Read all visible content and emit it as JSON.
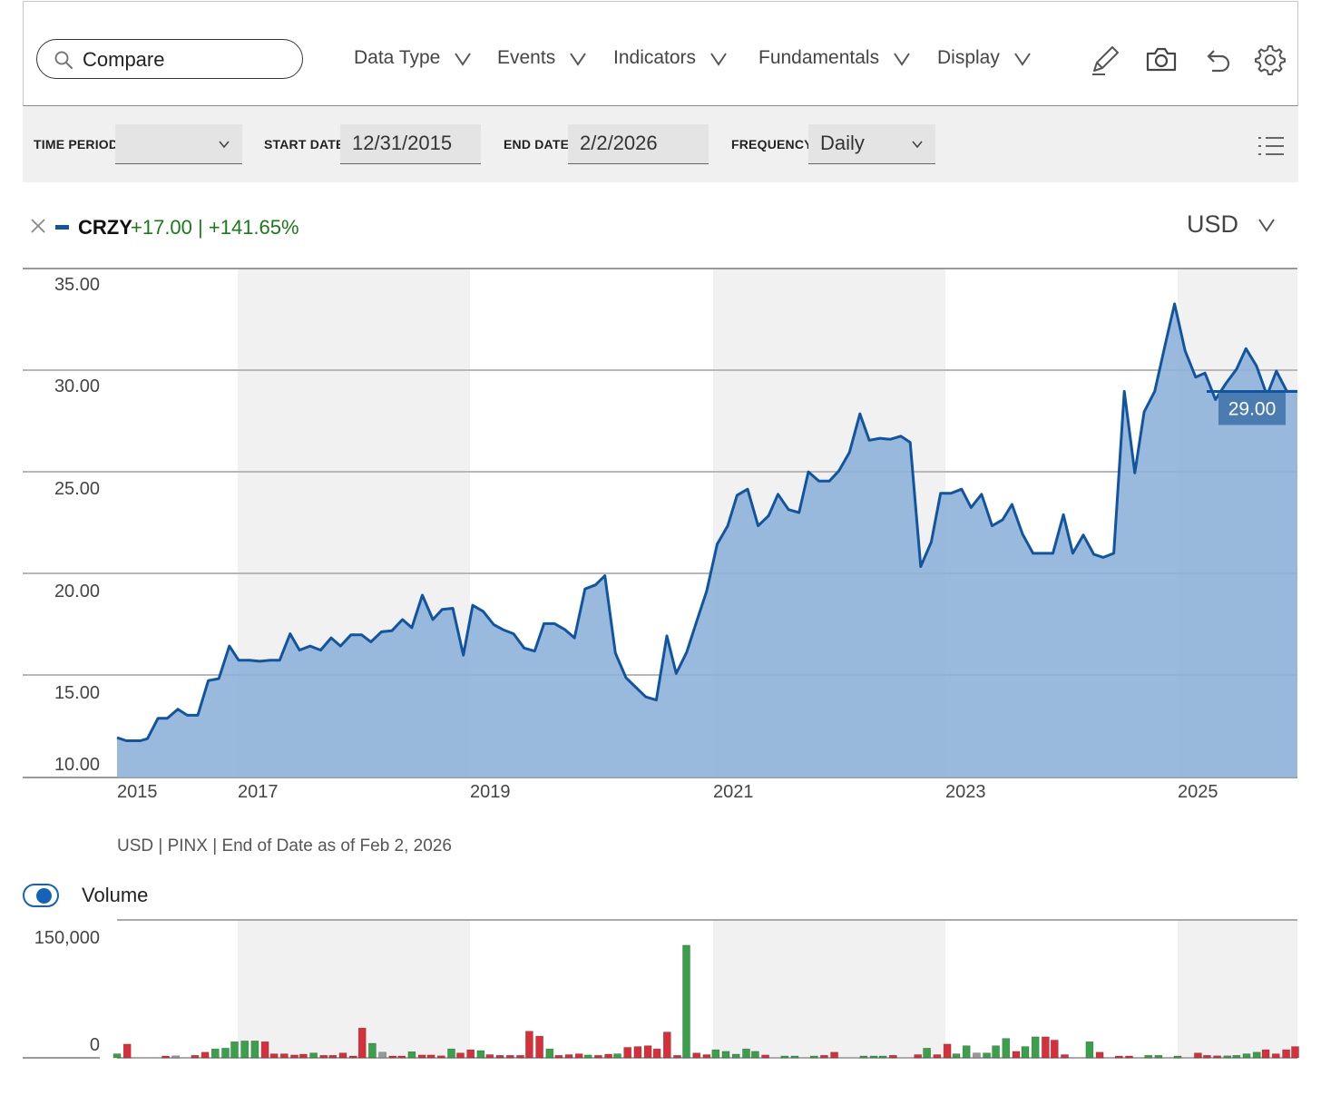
{
  "toolbar": {
    "search_label": "Compare",
    "menus": [
      "Data Type",
      "Events",
      "Indicators",
      "Fundamentals",
      "Display"
    ],
    "tools": [
      "pencil-icon",
      "camera-icon",
      "undo-icon",
      "gear-icon"
    ]
  },
  "filters": {
    "time_period_label": "TIME PERIOD",
    "time_period_value": "",
    "start_date_label": "START DATE",
    "start_date_value": "12/31/2015",
    "end_date_label": "END DATE",
    "end_date_value": "2/2/2026",
    "frequency_label": "FREQUENCY",
    "frequency_value": "Daily"
  },
  "legend": {
    "symbol": "CRZY",
    "change": "+17.00",
    "separator": "|",
    "change_pct": "+141.65%",
    "currency": "USD"
  },
  "footnote": "USD | PINX | End of Date as of Feb 2, 2026",
  "volume": {
    "label": "Volume",
    "enabled": true
  },
  "colors": {
    "line": "#1155a0",
    "fill": "#8fb3d9",
    "price_tag": "#4a7cb2",
    "volume_up": "#3aa04a",
    "volume_down": "#d8303a",
    "band": "#f1f1f1"
  },
  "chart_data": [
    {
      "type": "area",
      "x_tick_labels": [
        "2015",
        "2017",
        "2019",
        "2021",
        "2023",
        "2025"
      ],
      "y_tick_labels": [
        "35.00",
        "30.00",
        "25.00",
        "20.00",
        "15.00",
        "10.00"
      ],
      "ylim": [
        10,
        35
      ],
      "xlim": [
        2016.0,
        2026.09
      ],
      "last_value_label": "29.00",
      "series": [
        {
          "points": [
            [
              2016.0,
              12.0
            ],
            [
              2016.08,
              11.85
            ],
            [
              2016.2,
              11.85
            ],
            [
              2016.26,
              11.95
            ],
            [
              2016.35,
              12.95
            ],
            [
              2016.43,
              12.95
            ],
            [
              2016.52,
              13.4
            ],
            [
              2016.6,
              13.1
            ],
            [
              2016.69,
              13.1
            ],
            [
              2016.78,
              14.8
            ],
            [
              2016.87,
              14.9
            ],
            [
              2016.96,
              16.5
            ],
            [
              2017.04,
              15.8
            ],
            [
              2017.13,
              15.8
            ],
            [
              2017.22,
              15.75
            ],
            [
              2017.31,
              15.8
            ],
            [
              2017.39,
              15.8
            ],
            [
              2017.48,
              17.1
            ],
            [
              2017.56,
              16.3
            ],
            [
              2017.65,
              16.5
            ],
            [
              2017.74,
              16.3
            ],
            [
              2017.83,
              16.9
            ],
            [
              2017.91,
              16.5
            ],
            [
              2018.0,
              17.05
            ],
            [
              2018.09,
              17.05
            ],
            [
              2018.17,
              16.7
            ],
            [
              2018.26,
              17.2
            ],
            [
              2018.35,
              17.25
            ],
            [
              2018.44,
              17.8
            ],
            [
              2018.52,
              17.4
            ],
            [
              2018.61,
              19.0
            ],
            [
              2018.7,
              17.8
            ],
            [
              2018.78,
              18.3
            ],
            [
              2018.87,
              18.35
            ],
            [
              2018.96,
              16.05
            ],
            [
              2019.04,
              18.5
            ],
            [
              2019.13,
              18.2
            ],
            [
              2019.22,
              17.55
            ],
            [
              2019.3,
              17.3
            ],
            [
              2019.39,
              17.1
            ],
            [
              2019.48,
              16.4
            ],
            [
              2019.57,
              16.25
            ],
            [
              2019.65,
              17.6
            ],
            [
              2019.74,
              17.6
            ],
            [
              2019.83,
              17.3
            ],
            [
              2019.91,
              16.9
            ],
            [
              2020.0,
              19.3
            ],
            [
              2020.09,
              19.5
            ],
            [
              2020.17,
              19.95
            ],
            [
              2020.26,
              16.15
            ],
            [
              2020.35,
              14.95
            ],
            [
              2020.43,
              14.5
            ],
            [
              2020.52,
              14.0
            ],
            [
              2020.61,
              13.85
            ],
            [
              2020.7,
              17.0
            ],
            [
              2020.78,
              15.15
            ],
            [
              2020.87,
              16.2
            ],
            [
              2020.96,
              17.8
            ],
            [
              2021.04,
              19.2
            ],
            [
              2021.13,
              21.5
            ],
            [
              2021.22,
              22.4
            ],
            [
              2021.3,
              23.9
            ],
            [
              2021.39,
              24.2
            ],
            [
              2021.48,
              22.4
            ],
            [
              2021.57,
              22.9
            ],
            [
              2021.65,
              23.95
            ],
            [
              2021.74,
              23.2
            ],
            [
              2021.83,
              23.05
            ],
            [
              2021.91,
              25.05
            ],
            [
              2022.0,
              24.6
            ],
            [
              2022.09,
              24.6
            ],
            [
              2022.17,
              25.1
            ],
            [
              2022.26,
              26.0
            ],
            [
              2022.35,
              27.9
            ],
            [
              2022.43,
              26.6
            ],
            [
              2022.52,
              26.7
            ],
            [
              2022.61,
              26.65
            ],
            [
              2022.7,
              26.8
            ],
            [
              2022.78,
              26.5
            ],
            [
              2022.87,
              20.4
            ],
            [
              2022.96,
              21.6
            ],
            [
              2023.04,
              24.0
            ],
            [
              2023.13,
              24.0
            ],
            [
              2023.22,
              24.2
            ],
            [
              2023.3,
              23.3
            ],
            [
              2023.39,
              23.95
            ],
            [
              2023.48,
              22.4
            ],
            [
              2023.57,
              22.7
            ],
            [
              2023.65,
              23.45
            ],
            [
              2023.74,
              22.0
            ],
            [
              2023.83,
              21.05
            ],
            [
              2023.91,
              21.05
            ],
            [
              2024.0,
              21.05
            ],
            [
              2024.09,
              22.95
            ],
            [
              2024.17,
              21.05
            ],
            [
              2024.26,
              21.95
            ],
            [
              2024.35,
              21.0
            ],
            [
              2024.43,
              20.85
            ],
            [
              2024.52,
              21.05
            ],
            [
              2024.61,
              29.0
            ],
            [
              2024.7,
              25.0
            ],
            [
              2024.78,
              28.0
            ],
            [
              2024.87,
              29.0
            ],
            [
              2024.96,
              31.3
            ],
            [
              2025.04,
              33.3
            ],
            [
              2025.13,
              31.0
            ],
            [
              2025.22,
              29.7
            ],
            [
              2025.3,
              29.9
            ],
            [
              2025.39,
              28.6
            ],
            [
              2025.48,
              29.4
            ],
            [
              2025.57,
              30.1
            ],
            [
              2025.65,
              31.1
            ],
            [
              2025.74,
              30.25
            ],
            [
              2025.83,
              28.8
            ],
            [
              2025.91,
              30.0
            ],
            [
              2026.0,
              29.0
            ],
            [
              2026.09,
              29.0
            ]
          ]
        }
      ]
    },
    {
      "type": "bar",
      "y_tick_labels": [
        "150,000",
        "0"
      ],
      "ylim": [
        0,
        150000
      ],
      "xlim": [
        2016.0,
        2026.09
      ],
      "series": [
        {
          "values_up_down": [
            [
              2016.0,
              5000,
              "up"
            ],
            [
              2016.09,
              17000,
              "down"
            ],
            [
              2016.43,
              1500,
              "down"
            ],
            [
              2016.52,
              2500,
              "flat"
            ],
            [
              2016.69,
              3000,
              "down"
            ],
            [
              2016.78,
              7000,
              "down"
            ],
            [
              2016.87,
              11000,
              "up"
            ],
            [
              2016.96,
              12000,
              "up"
            ],
            [
              2017.04,
              20000,
              "up"
            ],
            [
              2017.13,
              21000,
              "up"
            ],
            [
              2017.22,
              21000,
              "up"
            ],
            [
              2017.31,
              20000,
              "down"
            ],
            [
              2017.39,
              5000,
              "down"
            ],
            [
              2017.48,
              5000,
              "down"
            ],
            [
              2017.57,
              3500,
              "down"
            ],
            [
              2017.65,
              4500,
              "down"
            ],
            [
              2017.74,
              6000,
              "up"
            ],
            [
              2017.83,
              3000,
              "down"
            ],
            [
              2017.91,
              3000,
              "down"
            ],
            [
              2018.0,
              6000,
              "down"
            ],
            [
              2018.09,
              1000,
              "down"
            ],
            [
              2018.17,
              37000,
              "down"
            ],
            [
              2018.26,
              18000,
              "up"
            ],
            [
              2018.35,
              7000,
              "flat"
            ],
            [
              2018.44,
              1500,
              "down"
            ],
            [
              2018.52,
              1000,
              "down"
            ],
            [
              2018.61,
              7500,
              "up"
            ],
            [
              2018.7,
              3500,
              "down"
            ],
            [
              2018.78,
              3500,
              "down"
            ],
            [
              2018.87,
              2500,
              "down"
            ],
            [
              2018.96,
              11000,
              "up"
            ],
            [
              2019.04,
              6000,
              "down"
            ],
            [
              2019.13,
              10000,
              "down"
            ],
            [
              2019.22,
              9000,
              "up"
            ],
            [
              2019.3,
              4000,
              "down"
            ],
            [
              2019.39,
              3000,
              "down"
            ],
            [
              2019.48,
              3000,
              "down"
            ],
            [
              2019.57,
              3000,
              "down"
            ],
            [
              2019.65,
              33000,
              "down"
            ],
            [
              2019.74,
              27000,
              "down"
            ],
            [
              2019.83,
              11000,
              "up"
            ],
            [
              2019.91,
              3000,
              "down"
            ],
            [
              2020.0,
              4000,
              "down"
            ],
            [
              2020.09,
              5000,
              "down"
            ],
            [
              2020.17,
              3500,
              "up"
            ],
            [
              2020.26,
              3000,
              "down"
            ],
            [
              2020.35,
              4500,
              "down"
            ],
            [
              2020.43,
              5000,
              "up"
            ],
            [
              2020.52,
              13000,
              "down"
            ],
            [
              2020.61,
              14000,
              "down"
            ],
            [
              2020.7,
              15000,
              "down"
            ],
            [
              2020.78,
              11000,
              "down"
            ],
            [
              2020.87,
              32000,
              "down"
            ],
            [
              2020.96,
              3000,
              "down"
            ],
            [
              2021.04,
              140000,
              "up"
            ],
            [
              2021.13,
              6000,
              "down"
            ],
            [
              2021.22,
              4000,
              "down"
            ],
            [
              2021.3,
              10000,
              "up"
            ],
            [
              2021.39,
              8000,
              "up"
            ],
            [
              2021.48,
              4500,
              "up"
            ],
            [
              2021.57,
              11000,
              "up"
            ],
            [
              2021.65,
              8000,
              "up"
            ],
            [
              2021.74,
              3500,
              "down"
            ],
            [
              2021.91,
              1500,
              "up"
            ],
            [
              2022.0,
              2000,
              "up"
            ],
            [
              2022.17,
              2000,
              "up"
            ],
            [
              2022.26,
              3000,
              "down"
            ],
            [
              2022.35,
              7000,
              "down"
            ],
            [
              2022.61,
              2000,
              "up"
            ],
            [
              2022.7,
              2000,
              "up"
            ],
            [
              2022.78,
              2000,
              "up"
            ],
            [
              2022.87,
              3000,
              "down"
            ],
            [
              2023.09,
              4000,
              "down"
            ],
            [
              2023.17,
              12000,
              "up"
            ],
            [
              2023.26,
              4000,
              "down"
            ],
            [
              2023.35,
              17000,
              "down"
            ],
            [
              2023.43,
              5000,
              "up"
            ],
            [
              2023.52,
              15000,
              "up"
            ],
            [
              2023.61,
              6000,
              "flat"
            ],
            [
              2023.7,
              6000,
              "up"
            ],
            [
              2023.78,
              15000,
              "up"
            ],
            [
              2023.87,
              24000,
              "up"
            ],
            [
              2023.96,
              8000,
              "down"
            ],
            [
              2024.04,
              14000,
              "up"
            ],
            [
              2024.13,
              26000,
              "up"
            ],
            [
              2024.22,
              26000,
              "down"
            ],
            [
              2024.3,
              22000,
              "down"
            ],
            [
              2024.39,
              4000,
              "down"
            ],
            [
              2024.61,
              20000,
              "up"
            ],
            [
              2024.7,
              7000,
              "down"
            ],
            [
              2024.87,
              1000,
              "down"
            ],
            [
              2024.96,
              1000,
              "down"
            ],
            [
              2025.13,
              3000,
              "up"
            ],
            [
              2025.22,
              3000,
              "up"
            ],
            [
              2025.39,
              2000,
              "up"
            ],
            [
              2025.57,
              6000,
              "down"
            ],
            [
              2025.65,
              3000,
              "down"
            ],
            [
              2025.74,
              2500,
              "down"
            ],
            [
              2025.83,
              2500,
              "up"
            ],
            [
              2025.91,
              3000,
              "up"
            ],
            [
              2026.0,
              5000,
              "up"
            ],
            [
              2026.09,
              7000,
              "up"
            ],
            [
              2026.17,
              10000,
              "down"
            ],
            [
              2026.26,
              5000,
              "down"
            ],
            [
              2026.35,
              10000,
              "down"
            ],
            [
              2026.43,
              14000,
              "down"
            ]
          ]
        }
      ]
    }
  ]
}
